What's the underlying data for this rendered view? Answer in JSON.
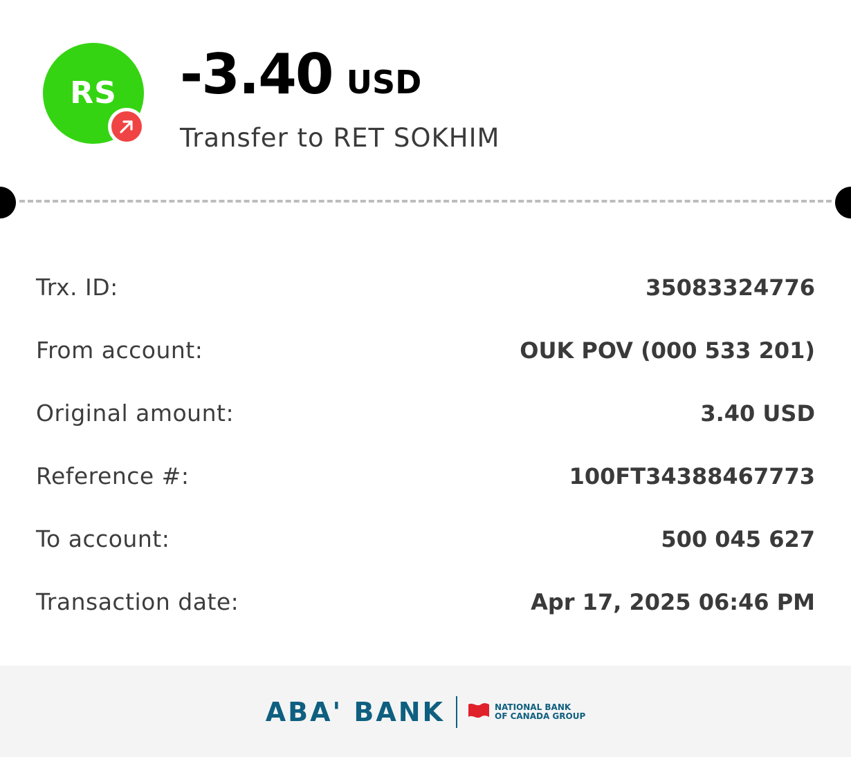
{
  "header": {
    "avatar_initials": "RS",
    "avatar_color": "#35d412",
    "badge_icon": "arrow-up-right-icon",
    "badge_color": "#f04444",
    "amount": "-3.40",
    "currency": "USD",
    "subtitle": "Transfer to RET SOKHIM"
  },
  "details": [
    {
      "label": "Trx. ID:",
      "value": "35083324776"
    },
    {
      "label": "From account:",
      "value": "OUK POV (000 533 201)"
    },
    {
      "label": "Original amount:",
      "value": "3.40 USD"
    },
    {
      "label": "Reference #:",
      "value": "100FT34388467773"
    },
    {
      "label": "To account:",
      "value": "500 045 627"
    },
    {
      "label": "Transaction date:",
      "value": "Apr 17, 2025 06:46 PM"
    }
  ],
  "footer": {
    "bank_logo": "ABA' BANK",
    "group_line1": "NATIONAL BANK",
    "group_line2": "OF CANADA GROUP",
    "brand_color": "#0e5f80",
    "flag_color": "#e0202a"
  }
}
